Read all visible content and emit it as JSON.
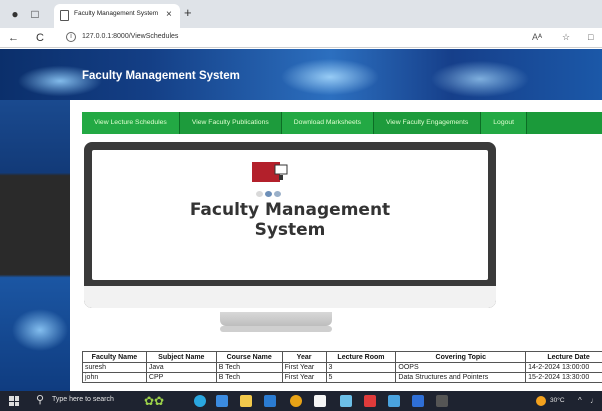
{
  "browser": {
    "tab_title": "Faculty Management System",
    "tab_close": "×",
    "new_tab": "+",
    "url": "127.0.0.1:8000/ViewSchedules",
    "back": "←",
    "reload": "C",
    "info": "i",
    "read_aloud": "Aᴬ",
    "favorite": "☆",
    "more": "□"
  },
  "site": {
    "title": "Faculty Management System"
  },
  "menu": [
    {
      "label": "View Lecture Schedules"
    },
    {
      "label": "View Faculty Publications"
    },
    {
      "label": "Download Marksheets"
    },
    {
      "label": "View Faculty Engagements"
    },
    {
      "label": "Logout"
    }
  ],
  "hero": {
    "line1": "Faculty Management",
    "line2": "System"
  },
  "table": {
    "headers": [
      "Faculty Name",
      "Subject Name",
      "Course Name",
      "Year",
      "Lecture Room",
      "Covering Topic",
      "Lecture Date"
    ],
    "rows": [
      [
        "suresh",
        "Java",
        "B Tech",
        "First Year",
        "3",
        "OOPS",
        "14-2-2024 13:00:00"
      ],
      [
        "john",
        "CPP",
        "B Tech",
        "First Year",
        "5",
        "Data Structures and Pointers",
        "15-2-2024 13:30:00"
      ]
    ]
  },
  "taskbar": {
    "search_placeholder": "Type here to search",
    "weather": "30°C",
    "tray_chevron": "^",
    "tray_speaker": "♩"
  },
  "colors": {
    "menu_green": "#23a944",
    "header_blue": "#143f86",
    "logo_red": "#b3202b"
  }
}
